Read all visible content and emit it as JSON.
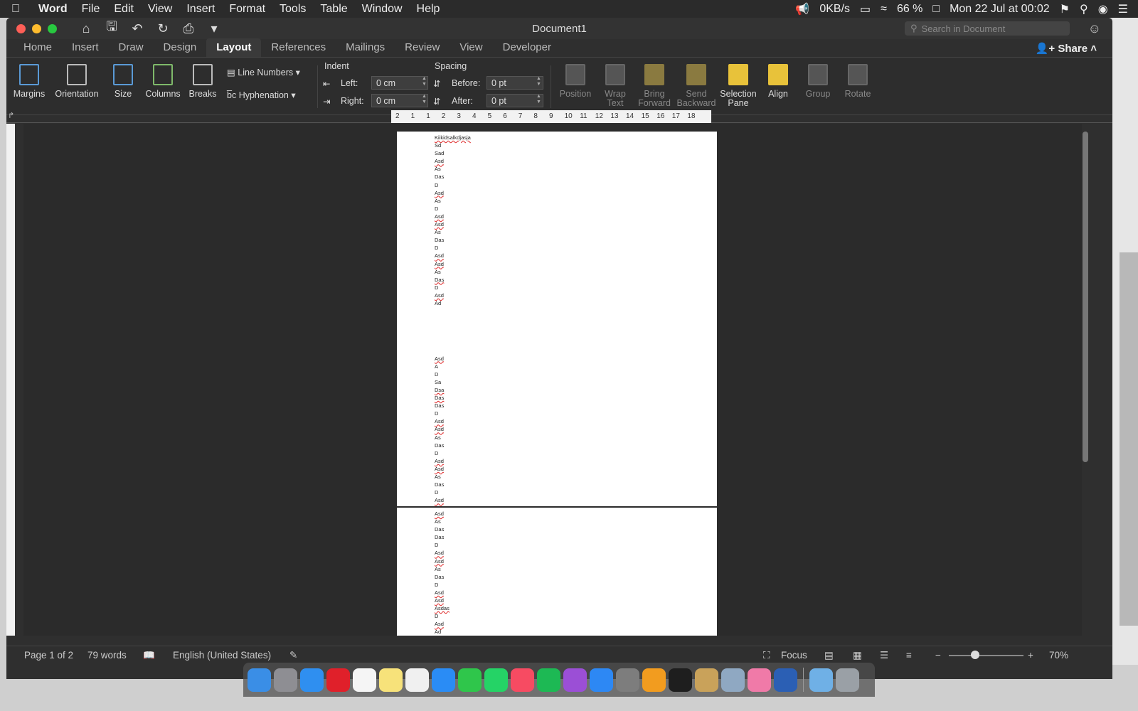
{
  "menubar": {
    "app_name": "Word",
    "items": [
      "File",
      "Edit",
      "View",
      "Insert",
      "Format",
      "Tools",
      "Table",
      "Window",
      "Help"
    ],
    "net_speed": "0KB/s",
    "battery": "66 %",
    "datetime": "Mon 22 Jul at  00:02"
  },
  "window": {
    "title": "Document1",
    "search_placeholder": "Search in Document",
    "tabs": [
      "Home",
      "Insert",
      "Draw",
      "Design",
      "Layout",
      "References",
      "Mailings",
      "Review",
      "View",
      "Developer"
    ],
    "active_tab": "Layout",
    "share_label": "Share"
  },
  "ribbon": {
    "margins": "Margins",
    "orientation": "Orientation",
    "size": "Size",
    "columns": "Columns",
    "breaks": "Breaks",
    "line_numbers": "Line Numbers",
    "hyphenation": "Hyphenation",
    "indent_label": "Indent",
    "left_label": "Left:",
    "left_value": "0 cm",
    "right_label": "Right:",
    "right_value": "0 cm",
    "spacing_label": "Spacing",
    "before_label": "Before:",
    "before_value": "0 pt",
    "after_label": "After:",
    "after_value": "0 pt",
    "position": "Position",
    "wrap_text_1": "Wrap",
    "wrap_text_2": "Text",
    "bring_forward_1": "Bring",
    "bring_forward_2": "Forward",
    "send_backward_1": "Send",
    "send_backward_2": "Backward",
    "selection_pane_1": "Selection",
    "selection_pane_2": "Pane",
    "align": "Align",
    "group": "Group",
    "rotate": "Rotate"
  },
  "ruler": [
    "2",
    "1",
    "1",
    "2",
    "3",
    "4",
    "5",
    "6",
    "7",
    "8",
    "9",
    "10",
    "11",
    "12",
    "13",
    "14",
    "15",
    "16",
    "17",
    "18"
  ],
  "document": {
    "page1_lines": [
      {
        "t": "Kiikidsalkdjasja",
        "err": true
      },
      {
        "t": "Sd"
      },
      {
        "t": "Sad"
      },
      {
        "t": "Asd",
        "err": true
      },
      {
        "t": "As"
      },
      {
        "t": "Das"
      },
      {
        "t": "D"
      },
      {
        "t": "Asd",
        "err": true
      },
      {
        "t": "As"
      },
      {
        "t": "D"
      },
      {
        "t": "Asd",
        "err": true
      },
      {
        "t": "Asd",
        "err": true
      },
      {
        "t": "As"
      },
      {
        "t": "Das"
      },
      {
        "t": "D"
      },
      {
        "t": "Asd",
        "err": true
      },
      {
        "t": "Asd",
        "err": true
      },
      {
        "t": "As"
      },
      {
        "t": "Das",
        "err": true
      },
      {
        "t": "D"
      },
      {
        "t": "Asd",
        "err": true
      },
      {
        "t": "Ad"
      },
      {
        "t": ""
      },
      {
        "t": ""
      },
      {
        "t": ""
      },
      {
        "t": ""
      },
      {
        "t": ""
      },
      {
        "t": ""
      },
      {
        "t": "Asd",
        "err": true
      },
      {
        "t": "A"
      },
      {
        "t": "D"
      },
      {
        "t": "Sa"
      },
      {
        "t": "Dsa",
        "err": true
      },
      {
        "t": "Das",
        "err": true
      },
      {
        "t": "Das"
      },
      {
        "t": "D"
      },
      {
        "t": "Asd",
        "err": true
      },
      {
        "t": "Asd",
        "err": true
      },
      {
        "t": "As"
      },
      {
        "t": "Das"
      },
      {
        "t": "D"
      },
      {
        "t": "Asd",
        "err": true
      },
      {
        "t": "Asd",
        "err": true
      },
      {
        "t": "As"
      },
      {
        "t": "Das"
      },
      {
        "t": "D"
      },
      {
        "t": "Asd",
        "err": true
      }
    ],
    "page2_lines": [
      {
        "t": "Asd",
        "err": true
      },
      {
        "t": "As"
      },
      {
        "t": "Das"
      },
      {
        "t": "Das"
      },
      {
        "t": "D"
      },
      {
        "t": "Asd",
        "err": true
      },
      {
        "t": "Asd",
        "err": true
      },
      {
        "t": "As"
      },
      {
        "t": "Das"
      },
      {
        "t": "D"
      },
      {
        "t": "Asd",
        "err": true
      },
      {
        "t": "Asd",
        "err": true
      },
      {
        "t": "Asdas",
        "err": true
      },
      {
        "t": "D"
      },
      {
        "t": "Asd",
        "err": true
      },
      {
        "t": "Ad"
      }
    ]
  },
  "statusbar": {
    "page": "Page 1 of 2",
    "words": "79 words",
    "language": "English (United States)",
    "focus": "Focus",
    "zoom": "70%",
    "zoom_fraction": 0.35
  },
  "dock": {
    "icons": [
      {
        "name": "finder-icon",
        "color": "#3a8ee6"
      },
      {
        "name": "launchpad-icon",
        "color": "#8e8e93"
      },
      {
        "name": "safari-icon",
        "color": "#2f8ff0"
      },
      {
        "name": "opera-icon",
        "color": "#e0202a"
      },
      {
        "name": "calendar-icon",
        "color": "#f5f5f5"
      },
      {
        "name": "notes-icon",
        "color": "#f7e27a"
      },
      {
        "name": "reminders-icon",
        "color": "#f0f0f0"
      },
      {
        "name": "messenger-icon",
        "color": "#2a8cf5"
      },
      {
        "name": "facetime-icon",
        "color": "#2fc64b"
      },
      {
        "name": "whatsapp-icon",
        "color": "#25d366"
      },
      {
        "name": "music-icon",
        "color": "#f74b62"
      },
      {
        "name": "spotify-icon",
        "color": "#1db954"
      },
      {
        "name": "podcasts-icon",
        "color": "#9b4fd6"
      },
      {
        "name": "app-store-icon",
        "color": "#2d88f4"
      },
      {
        "name": "system-preferences-icon",
        "color": "#7d7d7d"
      },
      {
        "name": "sublime-text-icon",
        "color": "#f29c1f"
      },
      {
        "name": "terminal-icon",
        "color": "#1e1e1e"
      },
      {
        "name": "archive-utility-icon",
        "color": "#c9a25a"
      },
      {
        "name": "preview-icon",
        "color": "#8fa8c2"
      },
      {
        "name": "folder-pink-icon",
        "color": "#f07aa8"
      },
      {
        "name": "word-icon",
        "color": "#2b5fb4"
      },
      {
        "name": "downloads-folder-icon",
        "color": "#6fb0e6"
      },
      {
        "name": "trash-icon",
        "color": "#9aa0a6"
      }
    ]
  }
}
